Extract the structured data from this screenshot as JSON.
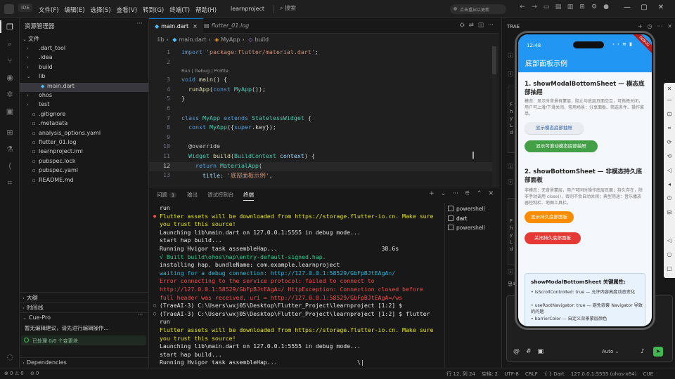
{
  "titlebar": {
    "ide_label": "IDE",
    "menu": [
      "文件(F)",
      "编辑(E)",
      "选择(S)",
      "查看(V)",
      "转到(G)",
      "终端(T)",
      "帮助(H)"
    ],
    "project": "learnproject",
    "search": "搜索",
    "update": "点击重启以更新"
  },
  "sidebar": {
    "title": "资源管理器",
    "section": "文件",
    "items": [
      {
        "label": ".dart_tool",
        "kind": "folder"
      },
      {
        "label": ".idea",
        "kind": "folder"
      },
      {
        "label": "build",
        "kind": "folder"
      },
      {
        "label": "lib",
        "kind": "folder-open"
      },
      {
        "label": "main.dart",
        "kind": "dart"
      },
      {
        "label": "ohos",
        "kind": "folder"
      },
      {
        "label": "test",
        "kind": "folder"
      },
      {
        "label": ".gitignore",
        "kind": "file"
      },
      {
        "label": ".metadata",
        "kind": "file"
      },
      {
        "label": "analysis_options.yaml",
        "kind": "file"
      },
      {
        "label": "flutter_01.log",
        "kind": "file"
      },
      {
        "label": "learnproject.iml",
        "kind": "file"
      },
      {
        "label": "pubspec.lock",
        "kind": "file"
      },
      {
        "label": "pubspec.yaml",
        "kind": "file"
      },
      {
        "label": "README.md",
        "kind": "file"
      }
    ],
    "outline": "大纲",
    "timeline": "时间线",
    "cue_title": "Cue-Pro",
    "cue_message": "暂无编辑建议，请先进行编辑操作...",
    "cue_status": "已处理 0/0 个变更块",
    "dependencies": "Dependencies"
  },
  "editor": {
    "tabs": [
      {
        "label": "main.dart",
        "active": true
      },
      {
        "label": "flutter_01.log",
        "active": false
      }
    ],
    "breadcrumb": [
      "lib",
      "main.dart",
      "MyApp",
      "build"
    ],
    "codelens": "Run | Debug | Profile",
    "current_line": 12,
    "lines": [
      {
        "n": "1",
        "html": "<span class=\"kw\">import</span> <span class=\"str\">'package:flutter/material.dart'</span><span class=\"txt\">;</span>"
      },
      {
        "n": "2",
        "html": ""
      },
      {
        "n": "3",
        "html": "<span class=\"kw\">void</span> <span class=\"fn\">main</span><span class=\"txt\">() {</span>"
      },
      {
        "n": "4",
        "html": "  <span class=\"fn\">runApp</span><span class=\"txt\">(</span><span class=\"kw\">const</span> <span class=\"cls\">MyApp</span><span class=\"txt\">());</span>"
      },
      {
        "n": "5",
        "html": "<span class=\"txt\">}</span>"
      },
      {
        "n": "6",
        "html": ""
      },
      {
        "n": "7",
        "html": "<span class=\"kw\">class</span> <span class=\"cls\">MyApp</span> <span class=\"kw\">extends</span> <span class=\"cls\">StatelessWidget</span> <span class=\"txt\">{</span>"
      },
      {
        "n": "8",
        "html": "  <span class=\"kw\">const</span> <span class=\"cls\">MyApp</span><span class=\"txt\">({</span><span class=\"kw\">super</span><span class=\"txt\">.key});</span>"
      },
      {
        "n": "9",
        "html": ""
      },
      {
        "n": "10",
        "html": "  <span class=\"ann\">@override</span>"
      },
      {
        "n": "11",
        "html": "  <span class=\"cls\">Widget</span> <span class=\"fn\">build</span><span class=\"txt\">(</span><span class=\"cls\">BuildContext</span> <span class=\"prm\">context</span><span class=\"txt\">) {</span>"
      },
      {
        "n": "12",
        "html": "    <span class=\"kw\">return</span> <span class=\"cls\">MaterialApp</span><span class=\"txt\">(</span>"
      },
      {
        "n": "13",
        "html": "      <span class=\"prm\">title</span><span class=\"txt\">: </span><span class=\"str\">'底部面板示例'</span><span class=\"txt\">,</span>"
      }
    ]
  },
  "panel": {
    "tabs": [
      {
        "label": "问题",
        "badge": "1"
      },
      {
        "label": "输出"
      },
      {
        "label": "调试控制台"
      },
      {
        "label": "终端",
        "active": true
      }
    ],
    "terminals": [
      "powershell",
      "dart",
      "powershell"
    ],
    "lines": [
      {
        "cls": "t-white",
        "mk": "",
        "text": "run"
      },
      {
        "cls": "t-yel",
        "mk": "red",
        "text": "Flutter assets will be downloaded from https://storage.flutter-io.cn. Make sure"
      },
      {
        "cls": "t-yel",
        "mk": "",
        "text": "you trust this source!"
      },
      {
        "cls": "t-white",
        "mk": "",
        "text": "Launching lib\\main.dart on 127.0.0.1:5555 in debug mode..."
      },
      {
        "cls": "t-white",
        "mk": "",
        "text": "start hap build..."
      },
      {
        "cls": "t-white",
        "mk": "",
        "text": "Running Hvigor task assembleHap...                              38.6s"
      },
      {
        "cls": "t-grn",
        "mk": "",
        "text": "√ Built build\\ohos\\hap\\entry-default-signed.hap."
      },
      {
        "cls": "t-white",
        "mk": "",
        "text": "installing hap. bundleName: com.example.learnproject"
      },
      {
        "cls": "t-cyan",
        "mk": "",
        "text": "waiting for a debug connection: http://127.0.0.1:58529/GbFpBJtEAgA=/"
      },
      {
        "cls": "t-red",
        "mk": "",
        "text": "Error connecting to the service protocol: failed to connect to"
      },
      {
        "cls": "t-red",
        "mk": "",
        "text": "http://127.0.0.1:58529/GbFpBJtEAgA=/ HttpException: Connection closed before"
      },
      {
        "cls": "t-red",
        "mk": "",
        "text": "full header was received, uri = http://127.0.0.1:58529/GbFpBJtEAgA=/ws"
      },
      {
        "cls": "t-white",
        "mk": "grey",
        "text": "(TraeAI-3) C:\\Users\\wxj05\\Desktop\\Flutter_Project\\learnproject [1:2] $"
      },
      {
        "cls": "t-white",
        "mk": "grey",
        "text": "(TraeAI-3) C:\\Users\\wxj05\\Desktop\\Flutter_Project\\learnproject [1:2] $ flutter"
      },
      {
        "cls": "t-white",
        "mk": "",
        "text": "run"
      },
      {
        "cls": "t-yel",
        "mk": "",
        "text": "Flutter assets will be downloaded from https://storage.flutter-io.cn. Make sure"
      },
      {
        "cls": "t-yel",
        "mk": "",
        "text": "you trust this source!"
      },
      {
        "cls": "t-white",
        "mk": "",
        "text": "Launching lib\\main.dart on 127.0.0.1:5555 in debug mode..."
      },
      {
        "cls": "t-white",
        "mk": "",
        "text": "start hap build..."
      },
      {
        "cls": "t-white",
        "mk": "",
        "text": "Running Hvigor task assembleHap...                       \\|"
      }
    ]
  },
  "right": {
    "title": "TRAE",
    "code_lines_1": [
      "F",
      "h",
      "y",
      "L",
      "d"
    ],
    "code_lines_2": [
      "F",
      "h",
      "y",
      "L",
      "d"
    ],
    "think_label": "思考",
    "input_placeholder": "",
    "auto_label": "Auto"
  },
  "phone": {
    "time": "12:48",
    "debug": "DEBUG",
    "appbar_title": "底部面板示例",
    "h1": "1. showModalBottomSheet — 模态底部抽屉",
    "d1": "模态：显示时背景有蒙层，阻止与底层页面交互，可拖拽关闭，用户可上滑/下滑关闭，常用场景：分享面板、筛选条件、操作菜单。",
    "btn1": "显示模态底部抽屉",
    "btn2": "显示可滚动模态底部抽屉",
    "h2": "2. showBottomSheet — 非模态持久底部面板",
    "d2": "非模态：无背景蒙层，用户可同时操作底层页面；持久存在，除非手动调用 close()，否则不会自动关闭；典型用途：音乐播放器控制栏、地图工具栏。",
    "btn3": "显示持久底部面板",
    "btn4": "关闭持久底部面板",
    "card_title": "showModalBottomSheet 关键属性:",
    "card_items": [
      "• isScrollControlled: true — 允许内容高度动态变化",
      "• useRootNavigator: true — 避免嵌套 Navigator 导致的问题",
      "• barrierColor — 自定义背景蒙层颜色"
    ]
  },
  "statusbar": {
    "left": [
      "⊗ 0 ⚠ 0",
      "⊘ 0"
    ],
    "right": [
      "行 12, 列 24",
      "空格: 2",
      "UTF-8",
      "CRLF",
      "{ } Dart",
      "127.0.0.1:5555 (ohos-x64)",
      "CUE"
    ]
  }
}
